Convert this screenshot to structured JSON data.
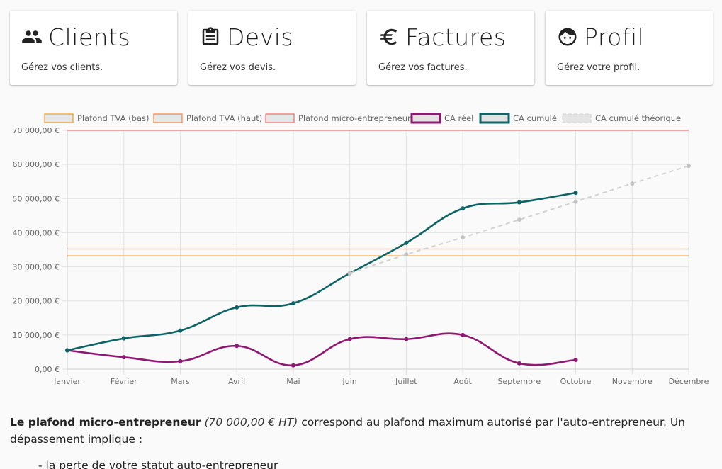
{
  "cards": [
    {
      "title": "Clients",
      "subtitle": "Gérez vos clients.",
      "icon": "people-icon"
    },
    {
      "title": "Devis",
      "subtitle": "Gérez vos devis.",
      "icon": "clipboard-icon"
    },
    {
      "title": "Factures",
      "subtitle": "Gérez vos factures.",
      "icon": "euro-icon"
    },
    {
      "title": "Profil",
      "subtitle": "Gérez votre profil.",
      "icon": "face-icon"
    }
  ],
  "chart_data": {
    "type": "line",
    "categories": [
      "Janvier",
      "Février",
      "Mars",
      "Avril",
      "Mai",
      "Juin",
      "Juillet",
      "Août",
      "Septembre",
      "Octobre",
      "Novembre",
      "Décembre"
    ],
    "y_ticks": [
      "0,00 €",
      "10 000,00 €",
      "20 000,00 €",
      "30 000,00 €",
      "40 000,00 €",
      "50 000,00 €",
      "60 000,00 €",
      "70 000,00 €"
    ],
    "ylim": [
      0,
      70000
    ],
    "grid": true,
    "legend_position": "top",
    "series": [
      {
        "name": "Plafond TVA (bas)",
        "kind": "threshold",
        "value": 33200,
        "color": "#f0a030",
        "fill": "#e6e6e6"
      },
      {
        "name": "Plafond TVA (haut)",
        "kind": "threshold",
        "value": 35200,
        "color": "#f08a4a",
        "fill": "#e6e6e6"
      },
      {
        "name": "Plafond micro-entrepreneur",
        "kind": "threshold",
        "value": 70000,
        "color": "#f07575",
        "fill": "#e6e6e6"
      },
      {
        "name": "CA réel",
        "kind": "line",
        "color": "#8e1872",
        "values": [
          5500,
          3500,
          2300,
          6800,
          1100,
          8800,
          8800,
          10000,
          1700,
          2700
        ]
      },
      {
        "name": "CA cumulé",
        "kind": "line",
        "color": "#0e6464",
        "values": [
          5500,
          9000,
          11300,
          18100,
          19300,
          28100,
          37000,
          47100,
          48900,
          51700
        ]
      },
      {
        "name": "CA cumulé théorique",
        "kind": "dashed",
        "color": "#d2d2d2",
        "start_index": 5,
        "values": [
          null,
          null,
          null,
          null,
          null,
          28100,
          33600,
          38600,
          43800,
          49100,
          54400,
          59600
        ]
      }
    ]
  },
  "text": {
    "strong": "Le plafond micro-entrepreneur",
    "italic": "(70 000,00 € HT)",
    "rest": " correspond au plafond maximum autorisé par l'auto-entrepreneur. Un dépassement implique :",
    "list_item": "- la perte de votre statut auto-entrepreneur"
  }
}
